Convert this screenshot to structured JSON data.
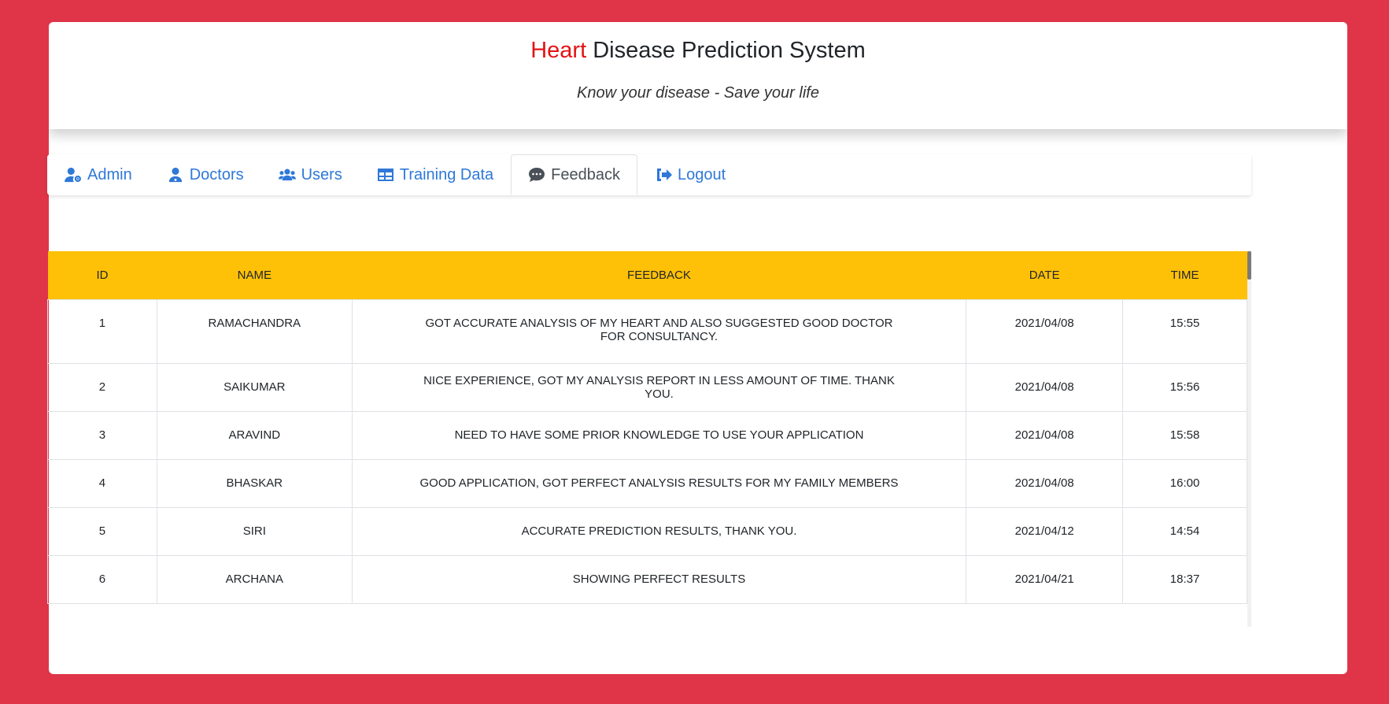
{
  "header": {
    "title_accent": "Heart",
    "title_rest": " Disease Prediction System",
    "subtitle": "Know your disease - Save your life"
  },
  "colors": {
    "background": "#e03548",
    "accent_red": "#e31414",
    "tab_link": "#2f78d8",
    "table_header": "#ffc107"
  },
  "tabs": [
    {
      "label": "Admin",
      "icon": "user-gear-icon",
      "active": false
    },
    {
      "label": "Doctors",
      "icon": "user-doctor-icon",
      "active": false
    },
    {
      "label": "Users",
      "icon": "users-icon",
      "active": false
    },
    {
      "label": "Training Data",
      "icon": "table-icon",
      "active": false
    },
    {
      "label": "Feedback",
      "icon": "comment-icon",
      "active": true
    },
    {
      "label": "Logout",
      "icon": "logout-icon",
      "active": false
    }
  ],
  "table": {
    "columns": [
      "ID",
      "NAME",
      "FEEDBACK",
      "DATE",
      "TIME"
    ],
    "rows": [
      [
        "1",
        "RAMACHANDRA",
        "GOT ACCURATE ANALYSIS OF MY HEART AND ALSO SUGGESTED GOOD DOCTOR FOR CONSULTANCY.",
        "2021/04/08",
        "15:55"
      ],
      [
        "2",
        "SAIKUMAR",
        "NICE EXPERIENCE, GOT MY ANALYSIS REPORT IN LESS AMOUNT OF TIME. THANK YOU.",
        "2021/04/08",
        "15:56"
      ],
      [
        "3",
        "ARAVIND",
        "NEED TO HAVE SOME PRIOR KNOWLEDGE TO USE YOUR APPLICATION",
        "2021/04/08",
        "15:58"
      ],
      [
        "4",
        "BHASKAR",
        "GOOD APPLICATION, GOT PERFECT ANALYSIS RESULTS FOR MY FAMILY MEMBERS",
        "2021/04/08",
        "16:00"
      ],
      [
        "5",
        "SIRI",
        "ACCURATE PREDICTION RESULTS, THANK YOU.",
        "2021/04/12",
        "14:54"
      ],
      [
        "6",
        "ARCHANA",
        "SHOWING PERFECT RESULTS",
        "2021/04/21",
        "18:37"
      ]
    ]
  }
}
